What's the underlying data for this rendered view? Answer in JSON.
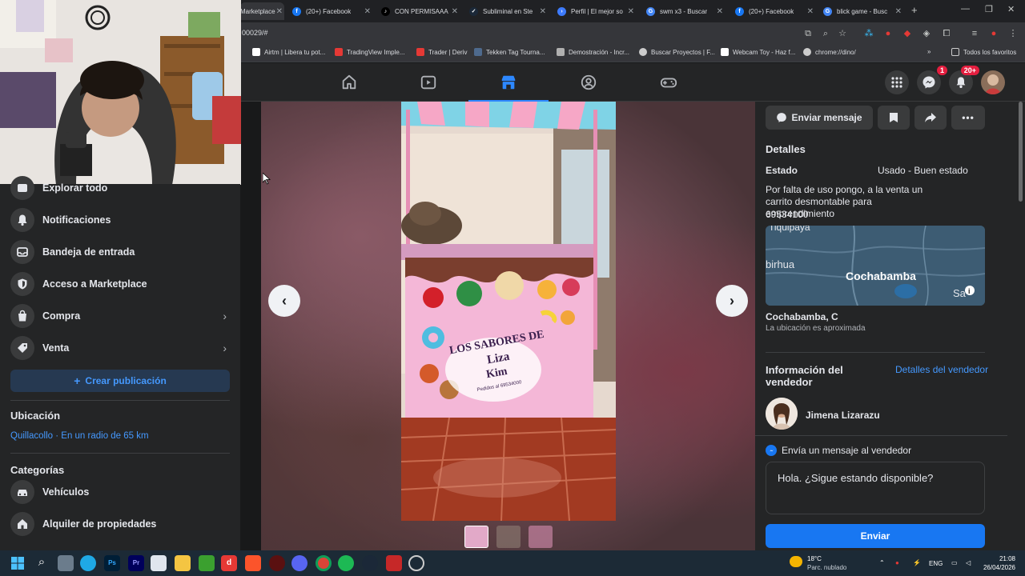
{
  "browser": {
    "tabs": [
      {
        "label": "Marketplace",
        "color": "#1877f2"
      },
      {
        "label": "(20+) Facebook",
        "color": "#1877f2"
      },
      {
        "label": "CON PERMISAAA",
        "color": "#000000"
      },
      {
        "label": "Subliminal en Ste",
        "color": "#1b2838"
      },
      {
        "label": "Perfil | El mejor so",
        "color": "#3d7bfd"
      },
      {
        "label": "swm x3 - Buscar",
        "color": "#4285f4"
      },
      {
        "label": "(20+) Facebook",
        "color": "#1877f2"
      },
      {
        "label": "blick game - Busc",
        "color": "#4285f4"
      }
    ],
    "url": "00029/#",
    "bookmarks": [
      {
        "label": "Airtm | Libera tu pot...",
        "color": "#ffffff"
      },
      {
        "label": "TradingView Imple...",
        "color": "#e53935"
      },
      {
        "label": "Trader | Deriv",
        "color": "#e53935"
      },
      {
        "label": "Tekken Tag Tourna...",
        "color": "#4e6a8d"
      },
      {
        "label": "Demostración - Incr...",
        "color": "#b0b0b0"
      },
      {
        "label": "Buscar Proyectos | F...",
        "color": "#cccccc"
      },
      {
        "label": "Webcam Toy - Haz f...",
        "color": "#ffffff"
      },
      {
        "label": "chrome://dino/",
        "color": "#cccccc"
      }
    ],
    "all_favorites": "Todos los favoritos"
  },
  "fbnav": {
    "tabs": [
      "home-icon",
      "watch-icon",
      "marketplace-icon",
      "groups-icon",
      "gaming-icon"
    ],
    "messenger_badge": "1",
    "notif_badge": "20+"
  },
  "sidebar": {
    "items": [
      {
        "label": "Explorar todo",
        "icon": "explore-icon"
      },
      {
        "label": "Notificaciones",
        "icon": "bell-icon"
      },
      {
        "label": "Bandeja de entrada",
        "icon": "inbox-icon"
      },
      {
        "label": "Acceso a Marketplace",
        "icon": "shield-icon"
      },
      {
        "label": "Compra",
        "icon": "shopping-bag-icon"
      },
      {
        "label": "Venta",
        "icon": "tag-icon"
      }
    ],
    "create_label": "Crear publicación",
    "location_title": "Ubicación",
    "location_value": "Quillacollo · En un radio de 65 km",
    "categories_title": "Categorías",
    "categories": [
      {
        "label": "Vehículos",
        "icon": "car-icon"
      },
      {
        "label": "Alquiler de propiedades",
        "icon": "home-icon"
      }
    ]
  },
  "listing": {
    "photo_texts": {
      "brand": "LOS SABORES DE",
      "name1": "Liza",
      "name2": "Kim",
      "orders": "Pedidos al 69534000"
    }
  },
  "details": {
    "send_message": "Enviar mensaje",
    "title": "Detalles",
    "condition_label": "Estado",
    "condition_value": "Usado - Buen estado",
    "description": "Por falta de uso pongo, a la venta un carrito desmontable para emprendimiento",
    "phone": "69534100",
    "map_labels": {
      "top": "Tiquipaya",
      "left": "birhua",
      "city": "Cochabamba",
      "right": "Sa"
    },
    "location": "Cochabamba, C",
    "location_note": "La ubicación es aproximada",
    "seller_title": "Información del vendedor",
    "seller_link": "Detalles del vendedor",
    "seller_name": "Jimena Lizarazu",
    "msg_prompt": "Envía un mensaje al vendedor",
    "msg_value": "Hola. ¿Sigue estando disponible?",
    "send_label": "Enviar"
  },
  "taskbar": {
    "weather_temp": "18°C",
    "weather_desc": "Parc. nublado",
    "lang": "ENG",
    "time": "21:08",
    "date": "26/04/2026"
  }
}
